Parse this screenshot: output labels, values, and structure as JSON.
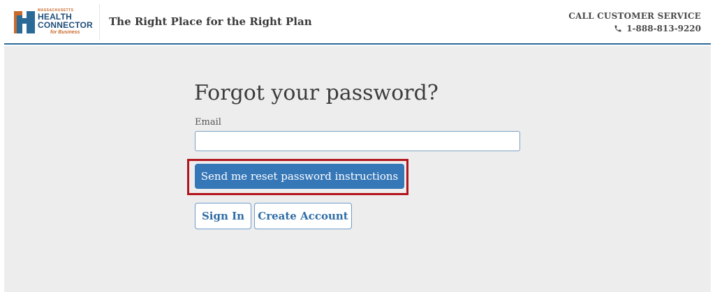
{
  "logo": {
    "top": "MASSACHUSETTS",
    "line1": "HEALTH",
    "line2": "CONNECTOR",
    "line3": "for Business",
    "colors": {
      "orange": "#c9692c",
      "blue": "#1f4e79",
      "teal": "#2b6a96"
    }
  },
  "header": {
    "tagline": "The Right Place for the Right Plan",
    "service_title": "CALL CUSTOMER SERVICE",
    "phone": "1-888-813-9220",
    "phone_icon": "phone-icon"
  },
  "form": {
    "title": "Forgot your password?",
    "email_label": "Email",
    "email_value": "",
    "submit_label": "Send me reset password instructions",
    "signin_label": "Sign In",
    "create_label": "Create Account"
  },
  "colors": {
    "primary": "#3677b8",
    "highlight": "#b3141c",
    "background": "#ededed"
  }
}
